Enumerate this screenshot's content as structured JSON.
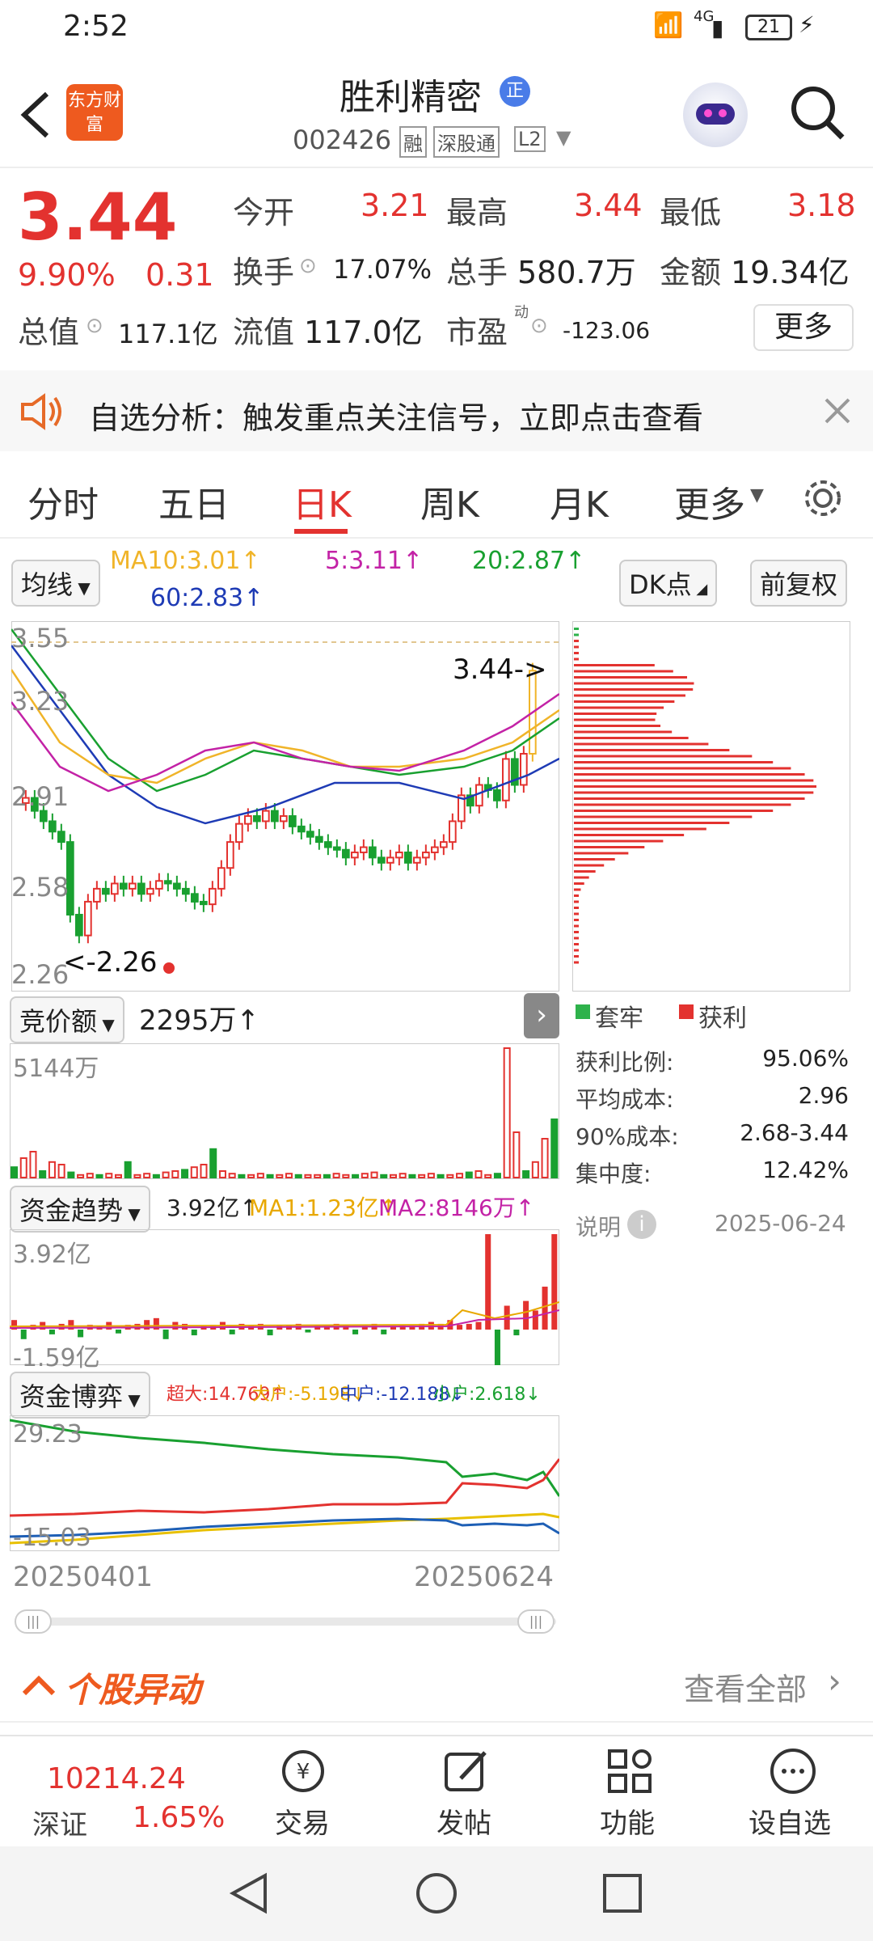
{
  "status": {
    "time": "2:52",
    "signal": "4G",
    "battery": "21"
  },
  "header": {
    "app_logo": "东方财富",
    "stock_name": "胜利精密",
    "badge": "正",
    "code": "002426",
    "tag_margin": "融",
    "tag_connect": "深股通",
    "tag_level": "L2"
  },
  "quote": {
    "price": "3.44",
    "change_pct": "9.90%",
    "change": "0.31",
    "open_label": "今开",
    "open": "3.21",
    "high_label": "最高",
    "high": "3.44",
    "low_label": "最低",
    "low": "3.18",
    "turnover_label": "换手",
    "turnover": "17.07%",
    "volume_label": "总手",
    "volume": "580.7万",
    "amount_label": "金额",
    "amount": "19.34亿",
    "mktcap_label": "总值",
    "mktcap": "117.1亿",
    "float_label": "流值",
    "float": "117.0亿",
    "pe_label": "市盈",
    "pe_sup": "动",
    "pe": "-123.06",
    "more": "更多"
  },
  "banner": {
    "text": "自选分析：触发重点关注信号，立即点击查看"
  },
  "tabs": [
    "分时",
    "五日",
    "日K",
    "周K",
    "月K",
    "更多"
  ],
  "ma": {
    "selector": "均线",
    "ma10": "MA10:3.01↑",
    "ma5": "5:3.11↑",
    "ma20": "20:2.87↑",
    "ma60": "60:2.83↑",
    "dk": "DK点",
    "adjust": "前复权"
  },
  "kline": {
    "y_top": "3.55",
    "y2": "3.23",
    "y3": "2.91",
    "y4": "2.58",
    "y_bottom": "2.26",
    "last_label": "3.44->",
    "low_label": "<-2.26"
  },
  "chip": {
    "legend_locked": "套牢",
    "legend_profit": "获利",
    "rows": [
      {
        "label": "获利比例:",
        "value": "95.06%"
      },
      {
        "label": "平均成本:",
        "value": "2.96"
      },
      {
        "label": "90%成本:",
        "value": "2.68-3.44"
      },
      {
        "label": "集中度:",
        "value": "12.42%"
      }
    ],
    "note": "说明",
    "date": "2025-06-24"
  },
  "auction": {
    "selector": "竞价额",
    "value": "2295万↑",
    "max": "5144万"
  },
  "fund_trend": {
    "selector": "资金趋势",
    "value": "3.92亿↑",
    "ma1": "MA1:1.23亿↑",
    "ma2": "MA2:8146万↑",
    "top": "3.92亿",
    "bottom": "-1.59亿"
  },
  "fund_game": {
    "selector": "资金博弈",
    "super": "超大:14.769↑",
    "big": "大户:-5.198↓",
    "mid": "中户:-12.188↓",
    "small": "小户:2.618↓",
    "top": "29.23",
    "bottom": "-15.03"
  },
  "dates": {
    "start": "20250401",
    "end": "20250624"
  },
  "movement": {
    "title": "个股异动",
    "view_all": "查看全部"
  },
  "bottom": {
    "index_value": "10214.24",
    "index_name": "深证",
    "index_pct": "1.65%",
    "trade": "交易",
    "post": "发帖",
    "func": "功能",
    "add": "设自选"
  }
}
